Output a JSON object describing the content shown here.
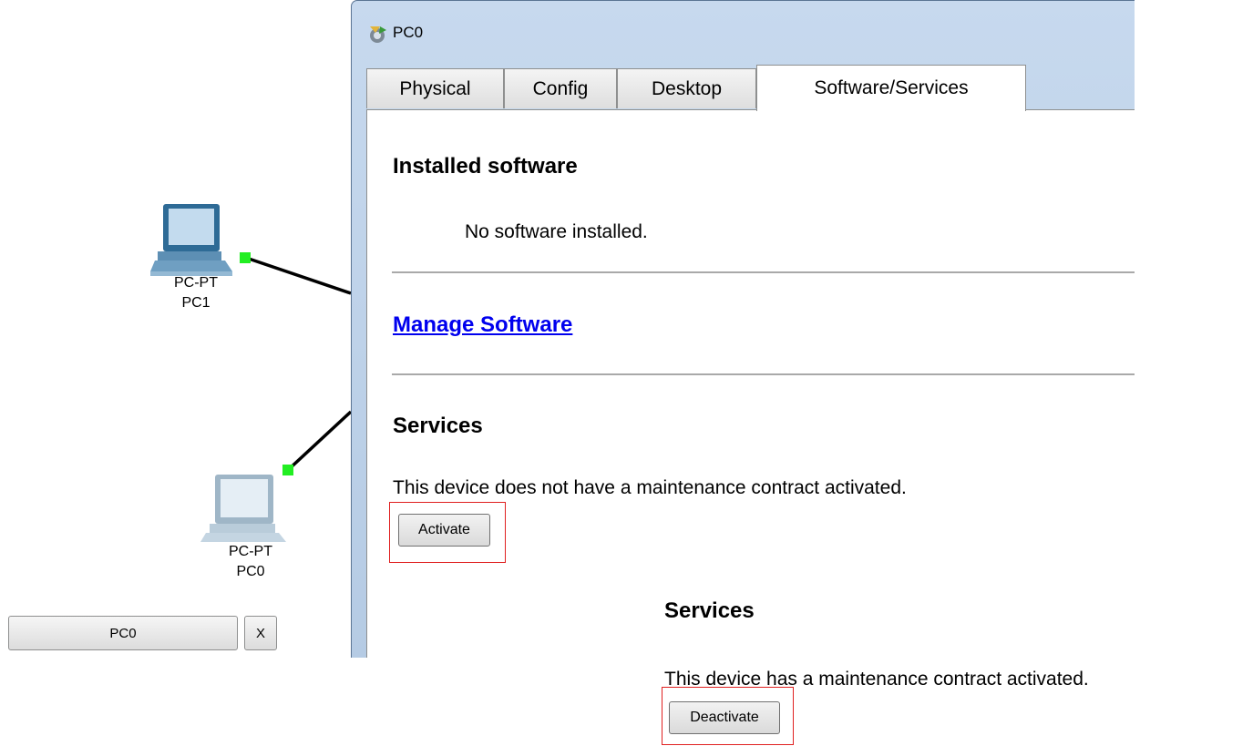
{
  "workspace": {
    "devices": [
      {
        "type_label": "PC-PT",
        "name": "PC1"
      },
      {
        "type_label": "PC-PT",
        "name": "PC0"
      }
    ],
    "taskbar": {
      "window_button": "PC0",
      "close_button": "X"
    }
  },
  "window": {
    "title": "PC0",
    "tabs": [
      {
        "label": "Physical"
      },
      {
        "label": "Config"
      },
      {
        "label": "Desktop"
      },
      {
        "label": "Software/Services",
        "active": true
      }
    ],
    "installed_software": {
      "heading": "Installed software",
      "status": "No software installed."
    },
    "manage_software_link": "Manage Software",
    "services": {
      "heading": "Services",
      "status": "This device does not have a maintenance contract activated.",
      "button": "Activate"
    }
  },
  "overlay": {
    "heading": "Services",
    "status": "This device has a maintenance contract activated.",
    "button": "Deactivate"
  },
  "colors": {
    "highlight": "#e02020",
    "link": "#0000ee",
    "link_dot": "#22ee22"
  }
}
